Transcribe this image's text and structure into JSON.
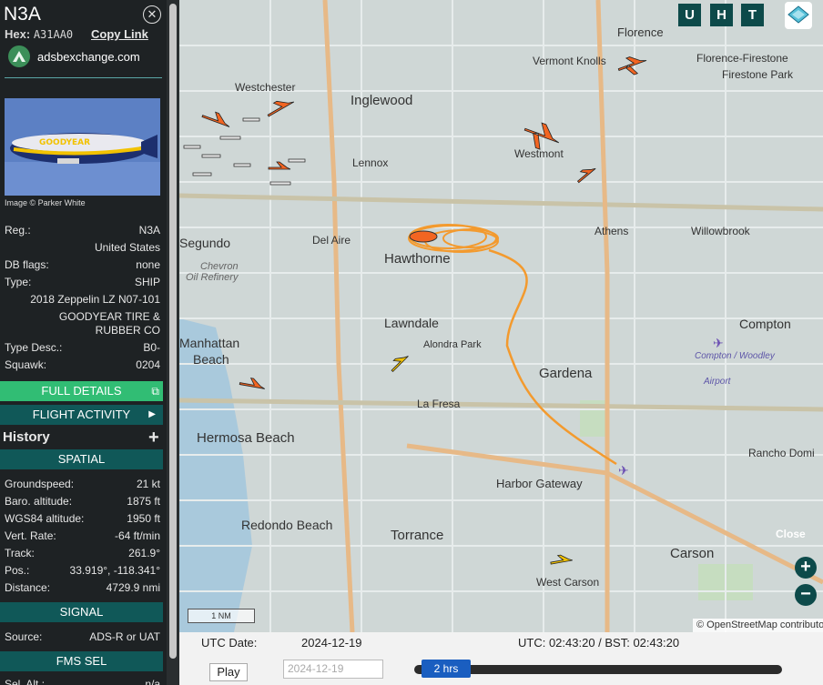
{
  "aircraft": {
    "callsign": "N3A",
    "hex_label": "Hex:",
    "hex": "A31AA0",
    "copy_link": "Copy Link",
    "source_site": "adsbexchange.com",
    "photo_credit": "Image © Parker White",
    "reg_label": "Reg.:",
    "reg": "N3A",
    "country": "United States",
    "dbflags_label": "DB flags:",
    "dbflags": "none",
    "type_label": "Type:",
    "type": "SHIP",
    "model": "2018 Zeppelin LZ N07-101",
    "owner_line1": "GOODYEAR TIRE &",
    "owner_line2": "RUBBER CO",
    "typedesc_label": "Type Desc.:",
    "typedesc": "B0-",
    "squawk_label": "Squawk:",
    "squawk": "0204"
  },
  "buttons": {
    "full_details": "FULL DETAILS",
    "flight_activity": "FLIGHT ACTIVITY",
    "history": "History"
  },
  "spatial": {
    "header": "SPATIAL",
    "rows": [
      {
        "label": "Groundspeed:",
        "value": "21 kt"
      },
      {
        "label": "Baro. altitude:",
        "value": "1875 ft"
      },
      {
        "label": "WGS84 altitude:",
        "value": "1950 ft"
      },
      {
        "label": "Vert. Rate:",
        "value": "-64 ft/min"
      },
      {
        "label": "Track:",
        "value": "261.9°"
      },
      {
        "label": "Pos.:",
        "value": "33.919°, -118.341°"
      },
      {
        "label": "Distance:",
        "value": "4729.9 nmi"
      }
    ]
  },
  "signal": {
    "header": "SIGNAL",
    "source_label": "Source:",
    "source_value": "ADS-R or UAT"
  },
  "fms": {
    "header": "FMS SEL",
    "sel_alt_label": "Sel. Alt.:",
    "sel_alt_value": "n/a"
  },
  "map": {
    "buttons": [
      "U",
      "H",
      "T"
    ],
    "close_label": "Close",
    "attribution": "© OpenStreetMap contributors",
    "scale": "1 NM",
    "places": [
      "Florence",
      "Westchester",
      "Inglewood",
      "Vermont Knolls",
      "Florence-Firestone",
      "Firestone Park",
      "Westmont",
      "Lennox",
      "Segundo",
      "Del Aire",
      "Hawthorne",
      "Athens",
      "Willowbrook",
      "Chevron",
      "Oil Refinery",
      "Lawndale",
      "Compton",
      "Manhattan",
      "Beach",
      "Alondra Park",
      "Gardena",
      "Compton / Woodley",
      "Airport",
      "La Fresa",
      "Hermosa Beach",
      "Rancho Domi",
      "Harbor Gateway",
      "Redondo Beach",
      "Torrance",
      "Carson",
      "West Carson"
    ]
  },
  "playback": {
    "utc_date_label": "UTC Date:",
    "utc_date": "2024-12-19",
    "time_text": "UTC: 02:43:20 / BST: 02:43:20",
    "play": "Play",
    "date_input": "2024-12-19",
    "range": "2 hrs"
  },
  "colors": {
    "accent_green": "#31bd74",
    "teal": "#105858",
    "track_orange": "#f39a2e",
    "plane_orange": "#f26522"
  }
}
